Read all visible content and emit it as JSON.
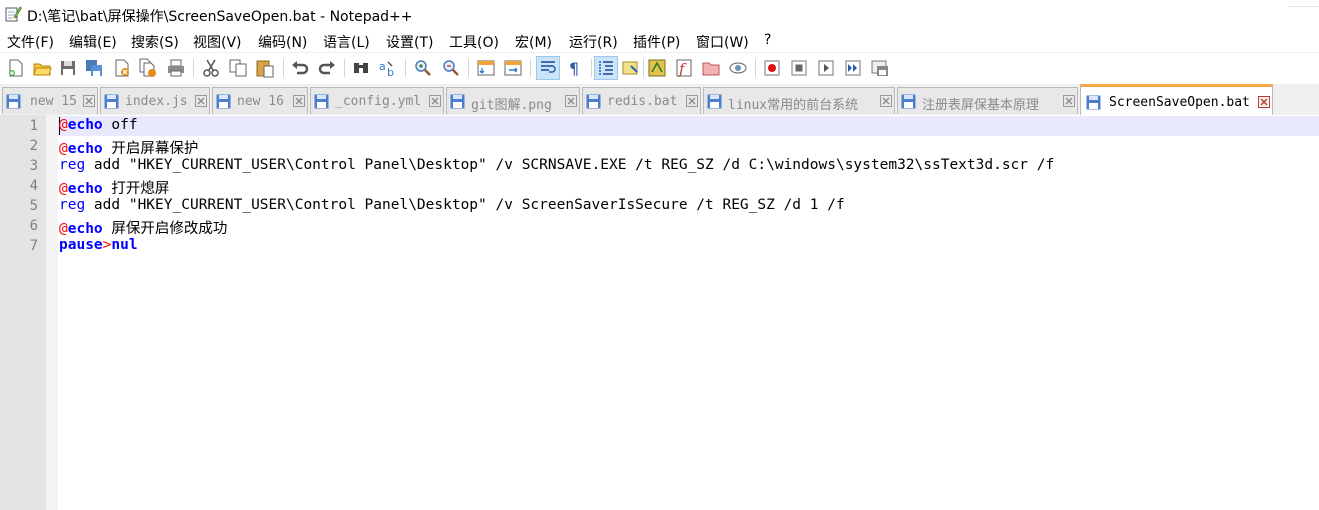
{
  "window": {
    "title": "D:\\笔记\\bat\\屏保操作\\ScreenSaveOpen.bat - Notepad++"
  },
  "menu": [
    "文件(F)",
    "编辑(E)",
    "搜索(S)",
    "视图(V)",
    "编码(N)",
    "语言(L)",
    "设置(T)",
    "工具(O)",
    "宏(M)",
    "运行(R)",
    "插件(P)",
    "窗口(W)",
    "?"
  ],
  "toolbar_icons": [
    "new-file-icon",
    "open-file-icon",
    "save-icon",
    "save-all-icon",
    "close-icon",
    "close-all-icon",
    "print-icon",
    "cut-icon",
    "copy-icon",
    "paste-icon",
    "undo-icon",
    "redo-icon",
    "find-icon",
    "replace-icon",
    "zoom-in-icon",
    "zoom-out-icon",
    "sync-vertical-icon",
    "sync-horizontal-icon",
    "word-wrap-icon",
    "show-all-chars-icon",
    "indent-guide-icon",
    "doc-map-icon",
    "function-list-icon",
    "folder-workspace-icon",
    "monitor-icon",
    "record-macro-icon",
    "stop-macro-icon",
    "play-macro-icon",
    "run-macro-multiple-icon",
    "save-macro-icon"
  ],
  "tabs": [
    {
      "label": "new 15",
      "active": false
    },
    {
      "label": "index.js",
      "active": false
    },
    {
      "label": "new 16",
      "active": false
    },
    {
      "label": "_config.yml",
      "active": false
    },
    {
      "label": "git图解.png",
      "active": false
    },
    {
      "label": "redis.bat",
      "active": false
    },
    {
      "label": "linux常用的前台系统",
      "active": false
    },
    {
      "label": "注册表屏保基本原理",
      "active": false
    },
    {
      "label": "ScreenSaveOpen.bat",
      "active": true
    }
  ],
  "editor": {
    "line_numbers": [
      "1",
      "2",
      "3",
      "4",
      "5",
      "6",
      "7"
    ],
    "lines": [
      {
        "at": "@",
        "kw": "echo",
        "rest": " off"
      },
      {
        "at": "@",
        "kw": "echo",
        "rest": " 开启屏幕保护"
      },
      {
        "cmd": "reg",
        "rest": " add \"HKEY_CURRENT_USER\\Control Panel\\Desktop\" /v SCRNSAVE.EXE /t REG_SZ /d C:\\windows\\system32\\ssText3d.scr /f"
      },
      {
        "at": "@",
        "kw": "echo",
        "rest": " 打开熄屏"
      },
      {
        "cmd": "reg",
        "rest": " add \"HKEY_CURRENT_USER\\Control Panel\\Desktop\" /v ScreenSaverIsSecure /t REG_SZ /d 1 /f"
      },
      {
        "at": "@",
        "kw": "echo",
        "rest": " 屏保开启修改成功"
      },
      {
        "kw": "pause",
        "op": ">",
        "kw2": "nul"
      }
    ]
  }
}
